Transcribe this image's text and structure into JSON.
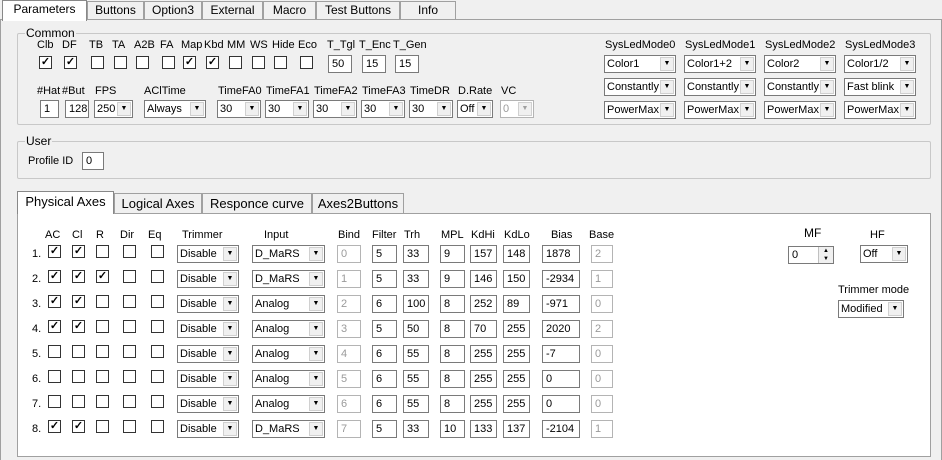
{
  "tabs": [
    {
      "label": "Parameters",
      "active": true
    },
    {
      "label": "Buttons"
    },
    {
      "label": "Option3"
    },
    {
      "label": "External"
    },
    {
      "label": "Macro"
    },
    {
      "label": "Test Buttons"
    },
    {
      "label": "Info"
    }
  ],
  "common": {
    "title": "Common",
    "flags": [
      {
        "label": "Clb",
        "checked": true
      },
      {
        "label": "DF",
        "checked": true
      },
      {
        "label": "TB",
        "checked": false
      },
      {
        "label": "TA",
        "checked": false
      },
      {
        "label": "A2B",
        "checked": false
      },
      {
        "label": "FA",
        "checked": false
      },
      {
        "label": "Map",
        "checked": true
      },
      {
        "label": "Kbd",
        "checked": true
      },
      {
        "label": "MM",
        "checked": false
      },
      {
        "label": "WS",
        "checked": false
      },
      {
        "label": "Hide",
        "checked": false
      },
      {
        "label": "Eco",
        "checked": false
      }
    ],
    "t_fields": [
      {
        "label": "T_Tgl",
        "value": "50"
      },
      {
        "label": "T_Enc",
        "value": "15"
      },
      {
        "label": "T_Gen",
        "value": "15"
      }
    ],
    "row2": [
      {
        "label": "#Hat",
        "kind": "text",
        "value": "1"
      },
      {
        "label": "#But",
        "kind": "text",
        "value": "128"
      },
      {
        "label": "FPS",
        "kind": "select",
        "value": "250"
      },
      {
        "label": "AClTime",
        "kind": "select",
        "value": "Always"
      },
      {
        "label": "TimeFA0",
        "kind": "select",
        "value": "30"
      },
      {
        "label": "TimeFA1",
        "kind": "select",
        "value": "30"
      },
      {
        "label": "TimeFA2",
        "kind": "select",
        "value": "30"
      },
      {
        "label": "TimeFA3",
        "kind": "select",
        "value": "30"
      },
      {
        "label": "TimeDR",
        "kind": "select",
        "value": "30"
      },
      {
        "label": "D.Rate",
        "kind": "select",
        "value": "Off"
      },
      {
        "label": "VC",
        "kind": "select",
        "value": "0",
        "disabled": true
      }
    ],
    "sysled": [
      {
        "label": "SysLedMode0",
        "values": [
          "Color1",
          "Constantly",
          "PowerMax"
        ]
      },
      {
        "label": "SysLedMode1",
        "values": [
          "Color1+2",
          "Constantly",
          "PowerMax"
        ]
      },
      {
        "label": "SysLedMode2",
        "values": [
          "Color2",
          "Constantly",
          "PowerMax"
        ]
      },
      {
        "label": "SysLedMode3",
        "values": [
          "Color1/2",
          "Fast blink",
          "PowerMax"
        ]
      }
    ]
  },
  "user": {
    "title": "User",
    "profile_label": "Profile ID",
    "profile_value": "0"
  },
  "axes_tabs": [
    {
      "label": "Physical Axes",
      "active": true
    },
    {
      "label": "Logical Axes"
    },
    {
      "label": "Responce curve"
    },
    {
      "label": "Axes2Buttons"
    }
  ],
  "axes": {
    "headers": {
      "ac": "AC",
      "cl": "Cl",
      "r": "R",
      "dir": "Dir",
      "eq": "Eq",
      "trimmer": "Trimmer",
      "input": "Input",
      "bind": "Bind",
      "filter": "Filter",
      "trh": "Trh",
      "mpl": "MPL",
      "kdhi": "KdHi",
      "kdlo": "KdLo",
      "bias": "Bias",
      "base": "Base"
    },
    "rows": [
      {
        "num": "1.",
        "ac": true,
        "cl": true,
        "r": false,
        "dir": false,
        "eq": false,
        "trimmer": "Disable",
        "input": "D_MaRS",
        "bind": "0",
        "filter": "5",
        "trh": "33",
        "mpl": "9",
        "kdhi": "157",
        "kdlo": "148",
        "bias": "1878",
        "base": "2"
      },
      {
        "num": "2.",
        "ac": true,
        "cl": true,
        "r": true,
        "dir": false,
        "eq": false,
        "trimmer": "Disable",
        "input": "D_MaRS",
        "bind": "1",
        "filter": "5",
        "trh": "33",
        "mpl": "9",
        "kdhi": "146",
        "kdlo": "150",
        "bias": "-2934",
        "base": "1"
      },
      {
        "num": "3.",
        "ac": true,
        "cl": true,
        "r": false,
        "dir": false,
        "eq": false,
        "trimmer": "Disable",
        "input": "Analog",
        "bind": "2",
        "filter": "6",
        "trh": "100",
        "mpl": "8",
        "kdhi": "252",
        "kdlo": "89",
        "bias": "-971",
        "base": "0"
      },
      {
        "num": "4.",
        "ac": true,
        "cl": true,
        "r": false,
        "dir": false,
        "eq": false,
        "trimmer": "Disable",
        "input": "Analog",
        "bind": "3",
        "filter": "5",
        "trh": "50",
        "mpl": "8",
        "kdhi": "70",
        "kdlo": "255",
        "bias": "2020",
        "base": "2"
      },
      {
        "num": "5.",
        "ac": false,
        "cl": false,
        "r": false,
        "dir": false,
        "eq": false,
        "trimmer": "Disable",
        "input": "Analog",
        "bind": "4",
        "filter": "6",
        "trh": "55",
        "mpl": "8",
        "kdhi": "255",
        "kdlo": "255",
        "bias": "-7",
        "base": "0"
      },
      {
        "num": "6.",
        "ac": false,
        "cl": false,
        "r": false,
        "dir": false,
        "eq": false,
        "trimmer": "Disable",
        "input": "Analog",
        "bind": "5",
        "filter": "6",
        "trh": "55",
        "mpl": "8",
        "kdhi": "255",
        "kdlo": "255",
        "bias": "0",
        "base": "0"
      },
      {
        "num": "7.",
        "ac": false,
        "cl": false,
        "r": false,
        "dir": false,
        "eq": false,
        "trimmer": "Disable",
        "input": "Analog",
        "bind": "6",
        "filter": "6",
        "trh": "55",
        "mpl": "8",
        "kdhi": "255",
        "kdlo": "255",
        "bias": "0",
        "base": "0"
      },
      {
        "num": "8.",
        "ac": true,
        "cl": true,
        "r": false,
        "dir": false,
        "eq": false,
        "trimmer": "Disable",
        "input": "D_MaRS",
        "bind": "7",
        "filter": "5",
        "trh": "33",
        "mpl": "10",
        "kdhi": "133",
        "kdlo": "137",
        "bias": "-2104",
        "base": "1"
      }
    ]
  },
  "mf": {
    "label": "MF",
    "value": "0"
  },
  "hf": {
    "label": "HF",
    "value": "Off"
  },
  "trimmer_mode": {
    "label": "Trimmer mode",
    "value": "Modified"
  }
}
